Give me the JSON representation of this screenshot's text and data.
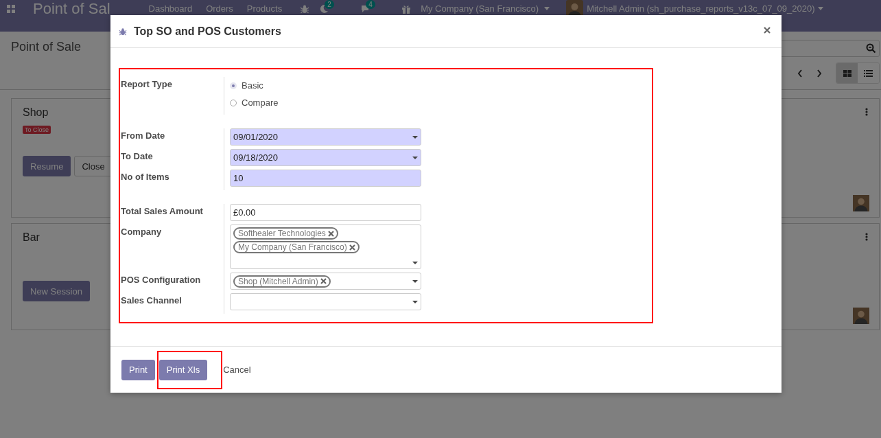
{
  "navbar": {
    "app_title": "Point of Sal",
    "menu": [
      "Dashboard",
      "Orders",
      "Products"
    ],
    "activity_count": "2",
    "message_count": "4",
    "company": "My Company (San Francisco)",
    "user": "Mitchell Admin (sh_purchase_reports_v13c_07_09_2020)"
  },
  "control_panel": {
    "title": "Point of Sale",
    "views": [
      {
        "kind": "kanban",
        "selected": true
      },
      {
        "kind": "list",
        "selected": false
      }
    ]
  },
  "cards": [
    {
      "title": "Shop",
      "badge": "To Close",
      "buttons": [
        {
          "label": "Resume",
          "kind": "primary"
        },
        {
          "label": "Close",
          "kind": "secondary"
        }
      ]
    },
    {
      "title": "Bar",
      "buttons": [
        {
          "label": "New Session",
          "kind": "primary"
        }
      ]
    }
  ],
  "dialog": {
    "title": "Top SO and POS Customers",
    "form": {
      "highlighted": true,
      "groups": [
        {
          "fields": [
            {
              "label": "Report Type",
              "kind": "radio",
              "options": [
                {
                  "label": "Basic",
                  "selected": true
                },
                {
                  "label": "Compare",
                  "selected": false
                }
              ]
            }
          ]
        },
        {
          "fields": [
            {
              "label": "From Date",
              "kind": "date",
              "value": "09/01/2020",
              "required": true
            },
            {
              "label": "To Date",
              "kind": "date",
              "value": "09/18/2020",
              "required": true
            },
            {
              "label": "No of Items",
              "kind": "text",
              "value": "10",
              "required": true
            }
          ]
        },
        {
          "fields": [
            {
              "label": "Total Sales Amount",
              "kind": "text",
              "value": "£0.00",
              "required": false
            },
            {
              "label": "Company",
              "kind": "tags",
              "tags": [
                "Softhealer Technologies",
                "My Company (San Francisco)"
              ],
              "wrap": true
            },
            {
              "label": "POS Configuration",
              "kind": "tags",
              "tags": [
                "Shop (Mitchell Admin)"
              ],
              "wrap": false
            },
            {
              "label": "Sales Channel",
              "kind": "select"
            }
          ]
        }
      ]
    },
    "buttons": [
      {
        "label": "Print",
        "kind": "primary",
        "highlighted": false
      },
      {
        "label": "Print Xls",
        "kind": "primary",
        "highlighted": true
      },
      {
        "label": "Cancel",
        "kind": "link",
        "highlighted": false
      }
    ]
  }
}
